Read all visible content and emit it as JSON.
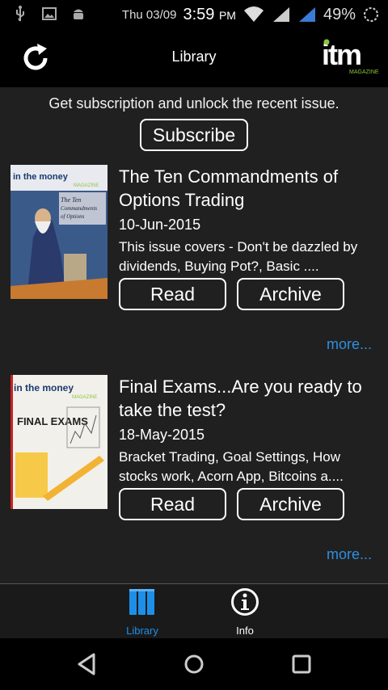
{
  "status_bar": {
    "date": "Thu 03/09",
    "time": "3:59",
    "ampm": "PM",
    "battery": "49%"
  },
  "header": {
    "title": "Library",
    "logo_text": "itm",
    "logo_sub": "MAGAZINE"
  },
  "promo": {
    "text": "Get subscription and unlock the recent issue.",
    "subscribe_label": "Subscribe"
  },
  "issues": [
    {
      "cover_brand": "in the money",
      "cover_magazine": "MAGAZINE",
      "cover_headline": "The Ten Commandments of Options Trading",
      "title": "The Ten Commandments of Options Trading",
      "date": "10-Jun-2015",
      "description": "This issue covers - Don't be dazzled by dividends, Buying Pot?, Basic ....",
      "read_label": "Read",
      "archive_label": "Archive",
      "more_label": "more..."
    },
    {
      "cover_brand": "in the money",
      "cover_magazine": "MAGAZINE",
      "cover_headline": "FINAL EXAMS",
      "title": "Final Exams...Are you ready to take the test?",
      "date": "18-May-2015",
      "description": "Bracket Trading, Goal Settings, How stocks work, Acorn App, Bitcoins a....",
      "read_label": "Read",
      "archive_label": "Archive",
      "more_label": "more..."
    }
  ],
  "tabs": [
    {
      "label": "Library",
      "icon": "library-icon",
      "active": true,
      "color": "#1e8fe8"
    },
    {
      "label": "Info",
      "icon": "info-icon",
      "active": false,
      "color": "#ffffff"
    }
  ],
  "colors": {
    "accent": "#1e8fe8",
    "link": "#2f8fe0",
    "content_bg": "#202020",
    "logo_green": "#8cc63f"
  }
}
